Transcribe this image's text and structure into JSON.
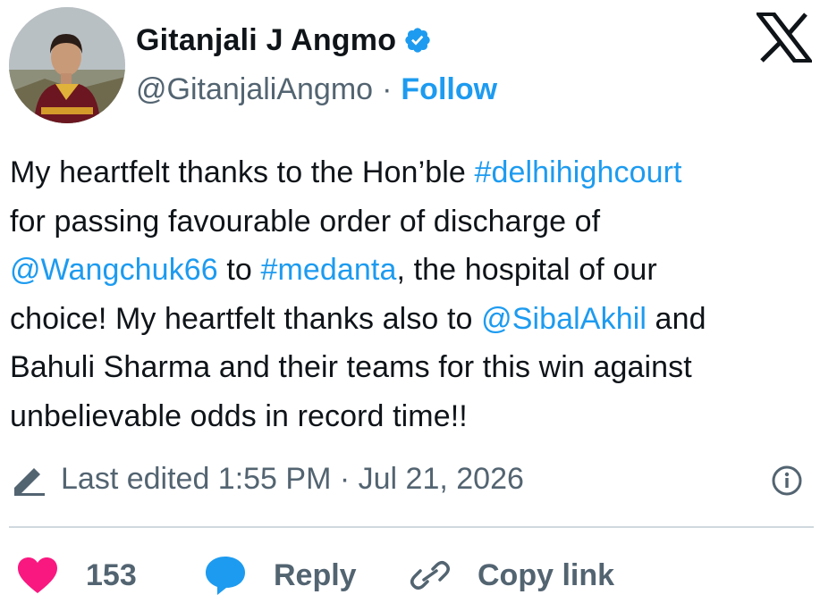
{
  "author": {
    "name": "Gitanjali J Angmo",
    "handle": "@GitanjaliAngmo",
    "separator": "·",
    "follow_label": "Follow",
    "verified_icon": "verified-badge-icon",
    "avatar_icon": "avatar"
  },
  "platform": {
    "logo_icon": "x-logo-icon"
  },
  "tweet": {
    "lines": [
      [
        {
          "text": "My heartfelt thanks to the Hon’ble ",
          "link": false
        },
        {
          "text": "#delhihighcourt",
          "link": true
        }
      ],
      [
        {
          "text": "for passing favourable order of discharge of",
          "link": false
        }
      ],
      [
        {
          "text": "@Wangchuk66",
          "link": true
        },
        {
          "text": " to ",
          "link": false
        },
        {
          "text": "#medanta",
          "link": true
        },
        {
          "text": ", the hospital of our",
          "link": false
        }
      ],
      [
        {
          "text": "choice! My heartfelt thanks also to ",
          "link": false
        },
        {
          "text": "@SibalAkhil",
          "link": true
        },
        {
          "text": " and",
          "link": false
        }
      ],
      [
        {
          "text": "Bahuli Sharma and their teams for this win against",
          "link": false
        }
      ],
      [
        {
          "text": "unbelievable odds in record time!!",
          "link": false
        }
      ]
    ]
  },
  "meta": {
    "edited_text": "Last edited 1:55 PM · Jul 21, 2026",
    "edited_icon": "pencil-icon",
    "info_icon": "info-icon"
  },
  "actions": {
    "like_count": "153",
    "reply_label": "Reply",
    "copy_label": "Copy link"
  },
  "colors": {
    "text": "#0f1419",
    "secondary": "#536471",
    "link": "#1d9bf0",
    "like": "#f91880",
    "divider": "#cfd9de"
  }
}
